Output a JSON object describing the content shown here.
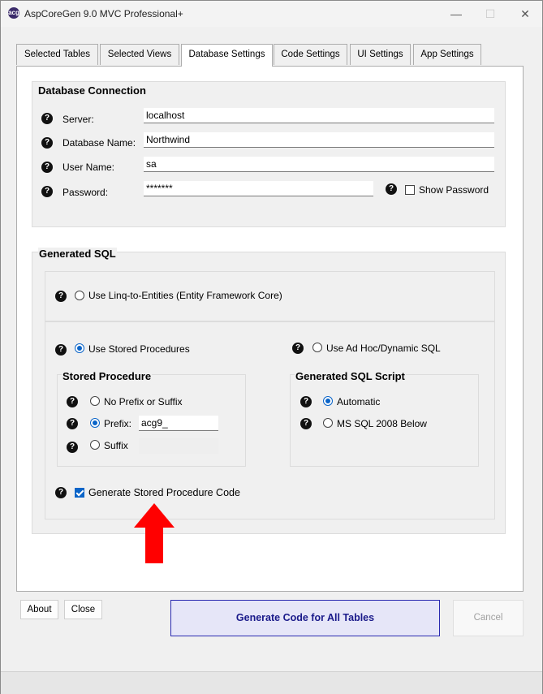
{
  "window": {
    "title": "AspCoreGen 9.0 MVC Professional+",
    "icon_text": "acg",
    "minimize_glyph": "—",
    "maximize_glyph": "☐",
    "close_glyph": "✕"
  },
  "tabs": [
    {
      "label": "Selected Tables"
    },
    {
      "label": "Selected Views"
    },
    {
      "label": "Database Settings",
      "active": true
    },
    {
      "label": "Code Settings"
    },
    {
      "label": "UI Settings"
    },
    {
      "label": "App Settings"
    }
  ],
  "db_connection": {
    "title": "Database Connection",
    "server_label": "Server:",
    "server_value": "localhost",
    "dbname_label": "Database Name:",
    "dbname_value": "Northwind",
    "username_label": "User Name:",
    "username_value": "sa",
    "password_label": "Password:",
    "password_value": "*******",
    "show_password_label": "Show Password",
    "show_password_checked": false
  },
  "generated_sql": {
    "title": "Generated SQL",
    "linq_label": "Use Linq-to-Entities (Entity Framework Core)",
    "linq_checked": false,
    "stored_proc_label": "Use Stored Procedures",
    "stored_proc_checked": true,
    "adhoc_label": "Use Ad Hoc/Dynamic SQL",
    "adhoc_checked": false,
    "stored_procedure_group": {
      "title": "Stored Procedure",
      "no_prefix_label": "No Prefix or Suffix",
      "prefix_label": "Prefix:",
      "prefix_value": "acg9_",
      "suffix_label": "Suffix",
      "suffix_value": ""
    },
    "script_group": {
      "title": "Generated SQL Script",
      "automatic_label": "Automatic",
      "ms_sql_label": "MS SQL 2008  Below"
    },
    "generate_sp_code_label": "Generate Stored Procedure Code",
    "generate_sp_code_checked": true
  },
  "help_glyph": "?",
  "footer": {
    "about_label": "About",
    "close_label": "Close",
    "generate_label": "Generate Code for All Tables",
    "cancel_label": "Cancel"
  },
  "colors": {
    "accent": "#0a64c8",
    "primary_button_border": "#2a2ab0",
    "annotation_arrow": "#ff0000"
  }
}
